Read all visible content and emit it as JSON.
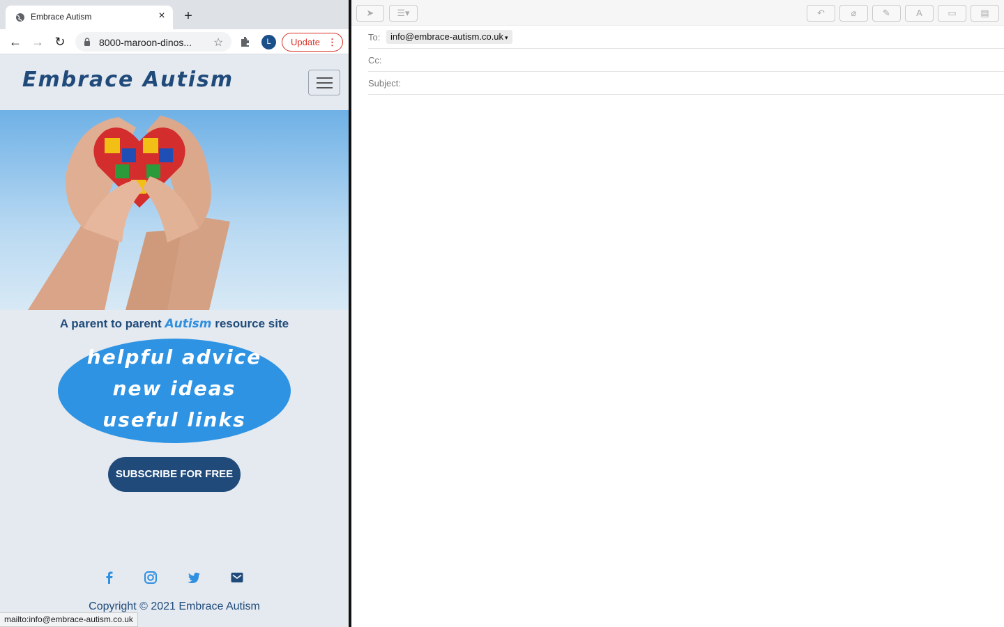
{
  "browser": {
    "tab_title": "Embrace Autism",
    "url": "8000-maroon-dinos...",
    "profile_initial": "L",
    "update_label": "Update",
    "status_url": "mailto:info@embrace-autism.co.uk"
  },
  "site": {
    "brand": "Embrace Autism",
    "tagline_pre": "A parent to parent",
    "tagline_accent": "Autism",
    "tagline_post": "resource site",
    "bubble_lines": [
      "helpful advice",
      "new ideas",
      "useful links"
    ],
    "subscribe_label": "SUBSCRIBE FOR FREE",
    "copyright": "Copyright © 2021 Embrace Autism",
    "colors": {
      "brand": "#1f4a7a",
      "accent": "#2f93e3",
      "background": "#e5eaf0"
    }
  },
  "mail": {
    "to_label": "To:",
    "to_recipient": "info@embrace-autism.co.uk",
    "cc_label": "Cc:",
    "subject_label": "Subject:"
  }
}
